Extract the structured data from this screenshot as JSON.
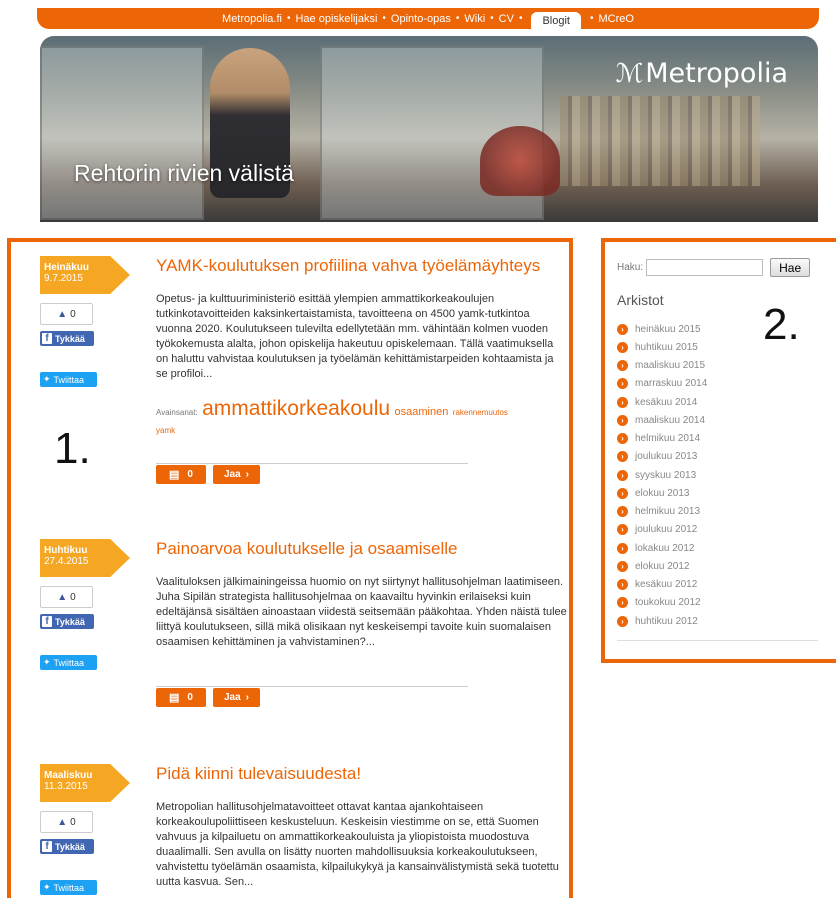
{
  "nav": {
    "items": [
      {
        "label": "Metropolia.fi",
        "active": false
      },
      {
        "label": "Hae opiskelijaksi",
        "active": false
      },
      {
        "label": "Opinto-opas",
        "active": false
      },
      {
        "label": "Wiki",
        "active": false
      },
      {
        "label": "CV",
        "active": false
      },
      {
        "label": "Blogit",
        "active": true
      },
      {
        "label": "MCreO",
        "active": false
      }
    ],
    "separator": "•"
  },
  "banner": {
    "logo_text": "Metropolia",
    "title": "Rehtorin rivien välistä"
  },
  "annotations": {
    "left": "1.",
    "right": "2."
  },
  "posts": [
    {
      "month": "Heinäkuu",
      "date": "9.7.2015",
      "title": "YAMK-koulutuksen profiilina vahva työelämäyhteys",
      "body": "Opetus- ja kulttuuriministeriö esittää ylempien ammattikorkeakoulujen tutkinkotavoitteiden kaksinkertaistamista, tavoitteena on 4500 yamk-tutkintoa vuonna 2020. Koulutukseen tulevilta edellytetään mm. vähintään kolmen vuoden työkokemusta alalta, johon opiskelija hakeutuu opiskelemaan. Tällä vaatimuksella on haluttu vahvistaa koulutuksen ja työelämän kehittämistarpeiden kohtaamista ja se profiloi...",
      "likes": "0",
      "fb_label": "Tykkää",
      "tw_label": "Twiittaa",
      "tags_label": "Avainsanat:",
      "tags": [
        "ammattikorkeakoulu",
        "osaaminen",
        "rakennemuutos",
        "yamk"
      ],
      "comments": "0",
      "share_label": "Jaa"
    },
    {
      "month": "Huhtikuu",
      "date": "27.4.2015",
      "title": "Painoarvoa koulutukselle ja osaamiselle",
      "body": "Vaalituloksen jälkimainingeissa huomio on nyt siirtynyt hallitusohjelman laatimiseen. Juha Sipilän strategista hallitusohjelmaa on kaavailtu hyvinkin erilaiseksi kuin edeltäjänsä sisältäen ainoastaan viidestä seitsemään pääkohtaa. Yhden näistä tulee liittyä koulutukseen, sillä mikä olisikaan nyt keskeisempi tavoite kuin suomalaisen osaamisen kehittäminen ja vahvistaminen?...",
      "likes": "0",
      "fb_label": "Tykkää",
      "tw_label": "Twiittaa",
      "comments": "0",
      "share_label": "Jaa"
    },
    {
      "month": "Maaliskuu",
      "date": "11.3.2015",
      "title": "Pidä kiinni tulevaisuudesta!",
      "body": "Metropolian hallitusohjelmatavoitteet ottavat kantaa ajankohtaiseen korkeakoulupoliittiseen keskusteluun. Keskeisin viestimme on se, että Suomen vahvuus ja kilpailuetu on ammattikorkeakouluista ja yliopistoista muodostuva duaalimalli. Sen avulla on lisätty nuorten mahdollisuuksia korkeakoulutukseen, vahvistettu työelämän osaamista, kilpailukykyä ja kansainvälistymistä sekä tuotettu uutta kasvua. Sen...",
      "likes": "0",
      "fb_label": "Tykkää",
      "tw_label": "Twiittaa"
    }
  ],
  "sidebar": {
    "search_label": "Haku:",
    "search_value": "",
    "search_button": "Hae",
    "archives_title": "Arkistot",
    "archives": [
      "heinäkuu 2015",
      "huhtikuu 2015",
      "maaliskuu 2015",
      "marraskuu 2014",
      "kesäkuu 2014",
      "maaliskuu 2014",
      "helmikuu 2014",
      "joulukuu 2013",
      "syyskuu 2013",
      "elokuu 2013",
      "helmikuu 2013",
      "joulukuu 2012",
      "lokakuu 2012",
      "elokuu 2012",
      "kesäkuu 2012",
      "toukokuu 2012",
      "huhtikuu 2012"
    ]
  },
  "colors": {
    "accent": "#ec6608",
    "date_flag": "#f5a623",
    "facebook": "#4267b2",
    "twitter": "#1da1f2"
  }
}
